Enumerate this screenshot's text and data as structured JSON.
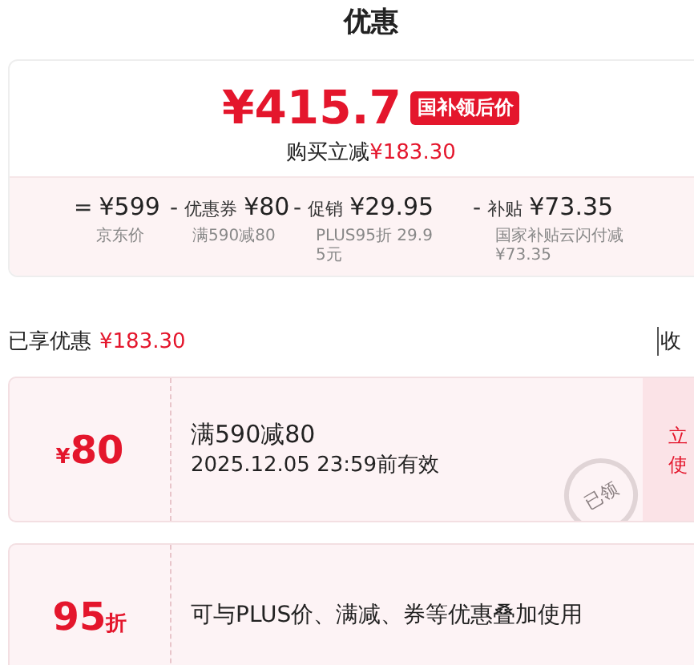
{
  "title": "优惠",
  "price_block": {
    "price": "¥415.7",
    "badge": "国补领后价",
    "reduction_label": "购买立减",
    "reduction_amount": "¥183.30"
  },
  "breakdown": [
    {
      "op": "=",
      "amount": "¥599",
      "note": "京东价"
    },
    {
      "op": "-",
      "label": "优惠券",
      "amount": "¥80",
      "note": "满590减80"
    },
    {
      "op": "-",
      "label": "促销",
      "amount": "¥29.95",
      "note": "PLUS95折 29.95元"
    },
    {
      "op": "-",
      "label": "补贴",
      "amount": "¥73.35",
      "note": "国家补贴云闪付减¥73.35"
    }
  ],
  "summary": {
    "label": "已享优惠",
    "amount": "¥183.30",
    "toggle": "收"
  },
  "coupons": [
    {
      "kind": "amount",
      "prefix": "¥",
      "value": "80",
      "lines": [
        "满590减80",
        "2025.12.05 23:59前有效"
      ],
      "stamp": "已领",
      "action": [
        "立",
        "使"
      ]
    },
    {
      "kind": "discount",
      "value": "95",
      "suffix": "折",
      "lines": [
        "可与PLUS价、满减、券等优惠叠加使用"
      ]
    }
  ]
}
